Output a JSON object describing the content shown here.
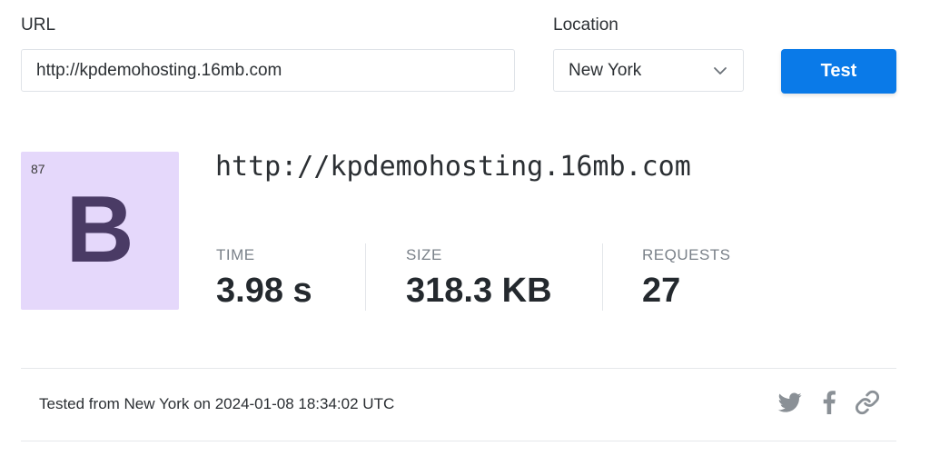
{
  "form": {
    "url_label": "URL",
    "url_value": "http://kpdemohosting.16mb.com",
    "location_label": "Location",
    "location_value": "New York",
    "test_button": "Test"
  },
  "result": {
    "score": "87",
    "grade": "B",
    "url": "http://kpdemohosting.16mb.com",
    "metrics": {
      "time_label": "TIME",
      "time_value": "3.98 s",
      "size_label": "SIZE",
      "size_value": "318.3 KB",
      "requests_label": "REQUESTS",
      "requests_value": "27"
    }
  },
  "footer": {
    "tested_text": "Tested from New York on 2024-01-08 18:34:02 UTC"
  },
  "share": {
    "icons": [
      "twitter-icon",
      "facebook-icon",
      "link-icon"
    ]
  },
  "colors": {
    "accent": "#0a7ae8",
    "grade_bg": "#e5d8fb",
    "grade_text": "#4a3b65",
    "icon": "#8a9096"
  }
}
